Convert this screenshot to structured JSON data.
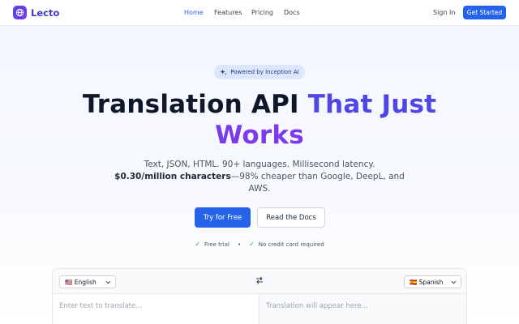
{
  "brand": {
    "name": "Lecto"
  },
  "nav": {
    "links": [
      {
        "label": "Home",
        "active": true
      },
      {
        "label": "Features",
        "active": false
      },
      {
        "label": "Pricing",
        "active": false
      },
      {
        "label": "Docs",
        "active": false
      }
    ],
    "sign_in": "Sign In",
    "get_started": "Get Started"
  },
  "hero": {
    "badge": "Powered by Inception AI",
    "headline_plain": "Translation API ",
    "headline_accent_1": "That Just",
    "headline_accent_2": "Works",
    "subtitle_line1": "Text, JSON, HTML. 90+ languages. Millisecond latency.",
    "subtitle_price": "$0.30/million characters",
    "subtitle_rest": "—98% cheaper than Google, DeepL, and AWS.",
    "cta_primary": "Try for Free",
    "cta_secondary": "Read the Docs",
    "checks": [
      "Free trial",
      "No credit card required"
    ]
  },
  "translator": {
    "source_language": "🇺🇸 English",
    "target_language": "🇪🇸 Spanish",
    "source_placeholder": "Enter text to translate...",
    "target_placeholder": "Translation will appear here..."
  },
  "colors": {
    "primary": "#2563eb",
    "accent_indigo": "#4f46e5",
    "accent_violet": "#7c3aed",
    "check_green": "#16a34a"
  },
  "icons": [
    "globe-icon",
    "sparkle-icon",
    "check-icon",
    "swap-icon",
    "chevron-down-icon"
  ]
}
